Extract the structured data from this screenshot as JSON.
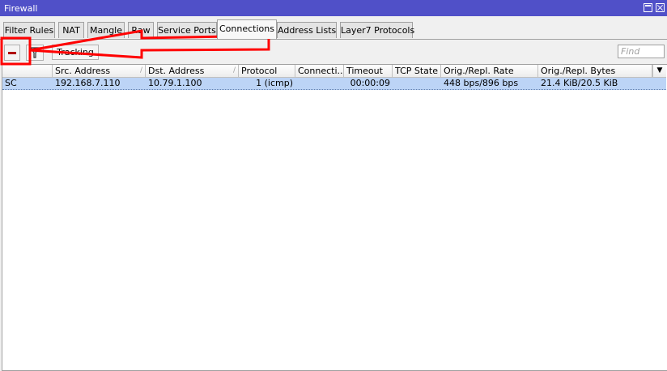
{
  "window": {
    "title": "Firewall"
  },
  "tabs": [
    {
      "label": "Filter Rules"
    },
    {
      "label": "NAT"
    },
    {
      "label": "Mangle"
    },
    {
      "label": "Raw"
    },
    {
      "label": "Service Ports"
    },
    {
      "label": "Connections",
      "active": true
    },
    {
      "label": "Address Lists"
    },
    {
      "label": "Layer7 Protocols"
    }
  ],
  "toolbar": {
    "remove_icon": "minus-icon",
    "filter_icon": "filter-icon",
    "tracking_label": "Tracking",
    "find_placeholder": "Find"
  },
  "table": {
    "columns": [
      "",
      "Src. Address",
      "Dst. Address",
      "Protocol",
      "Connecti...",
      "Timeout",
      "TCP State",
      "Orig./Repl. Rate",
      "Orig./Repl. Bytes"
    ],
    "rows": [
      {
        "flags": "SC",
        "src_address": "192.168.7.110",
        "dst_address": "10.79.1.100",
        "protocol": "1 (icmp)",
        "connection": "",
        "timeout": "00:00:09",
        "tcp_state": "",
        "rate": "448 bps/896 bps",
        "bytes": "21.4 KiB/20.5 KiB"
      }
    ]
  },
  "colors": {
    "titlebar": "#5050c8",
    "selected_row": "#bcd4f6",
    "annotation": "#ff0000"
  }
}
